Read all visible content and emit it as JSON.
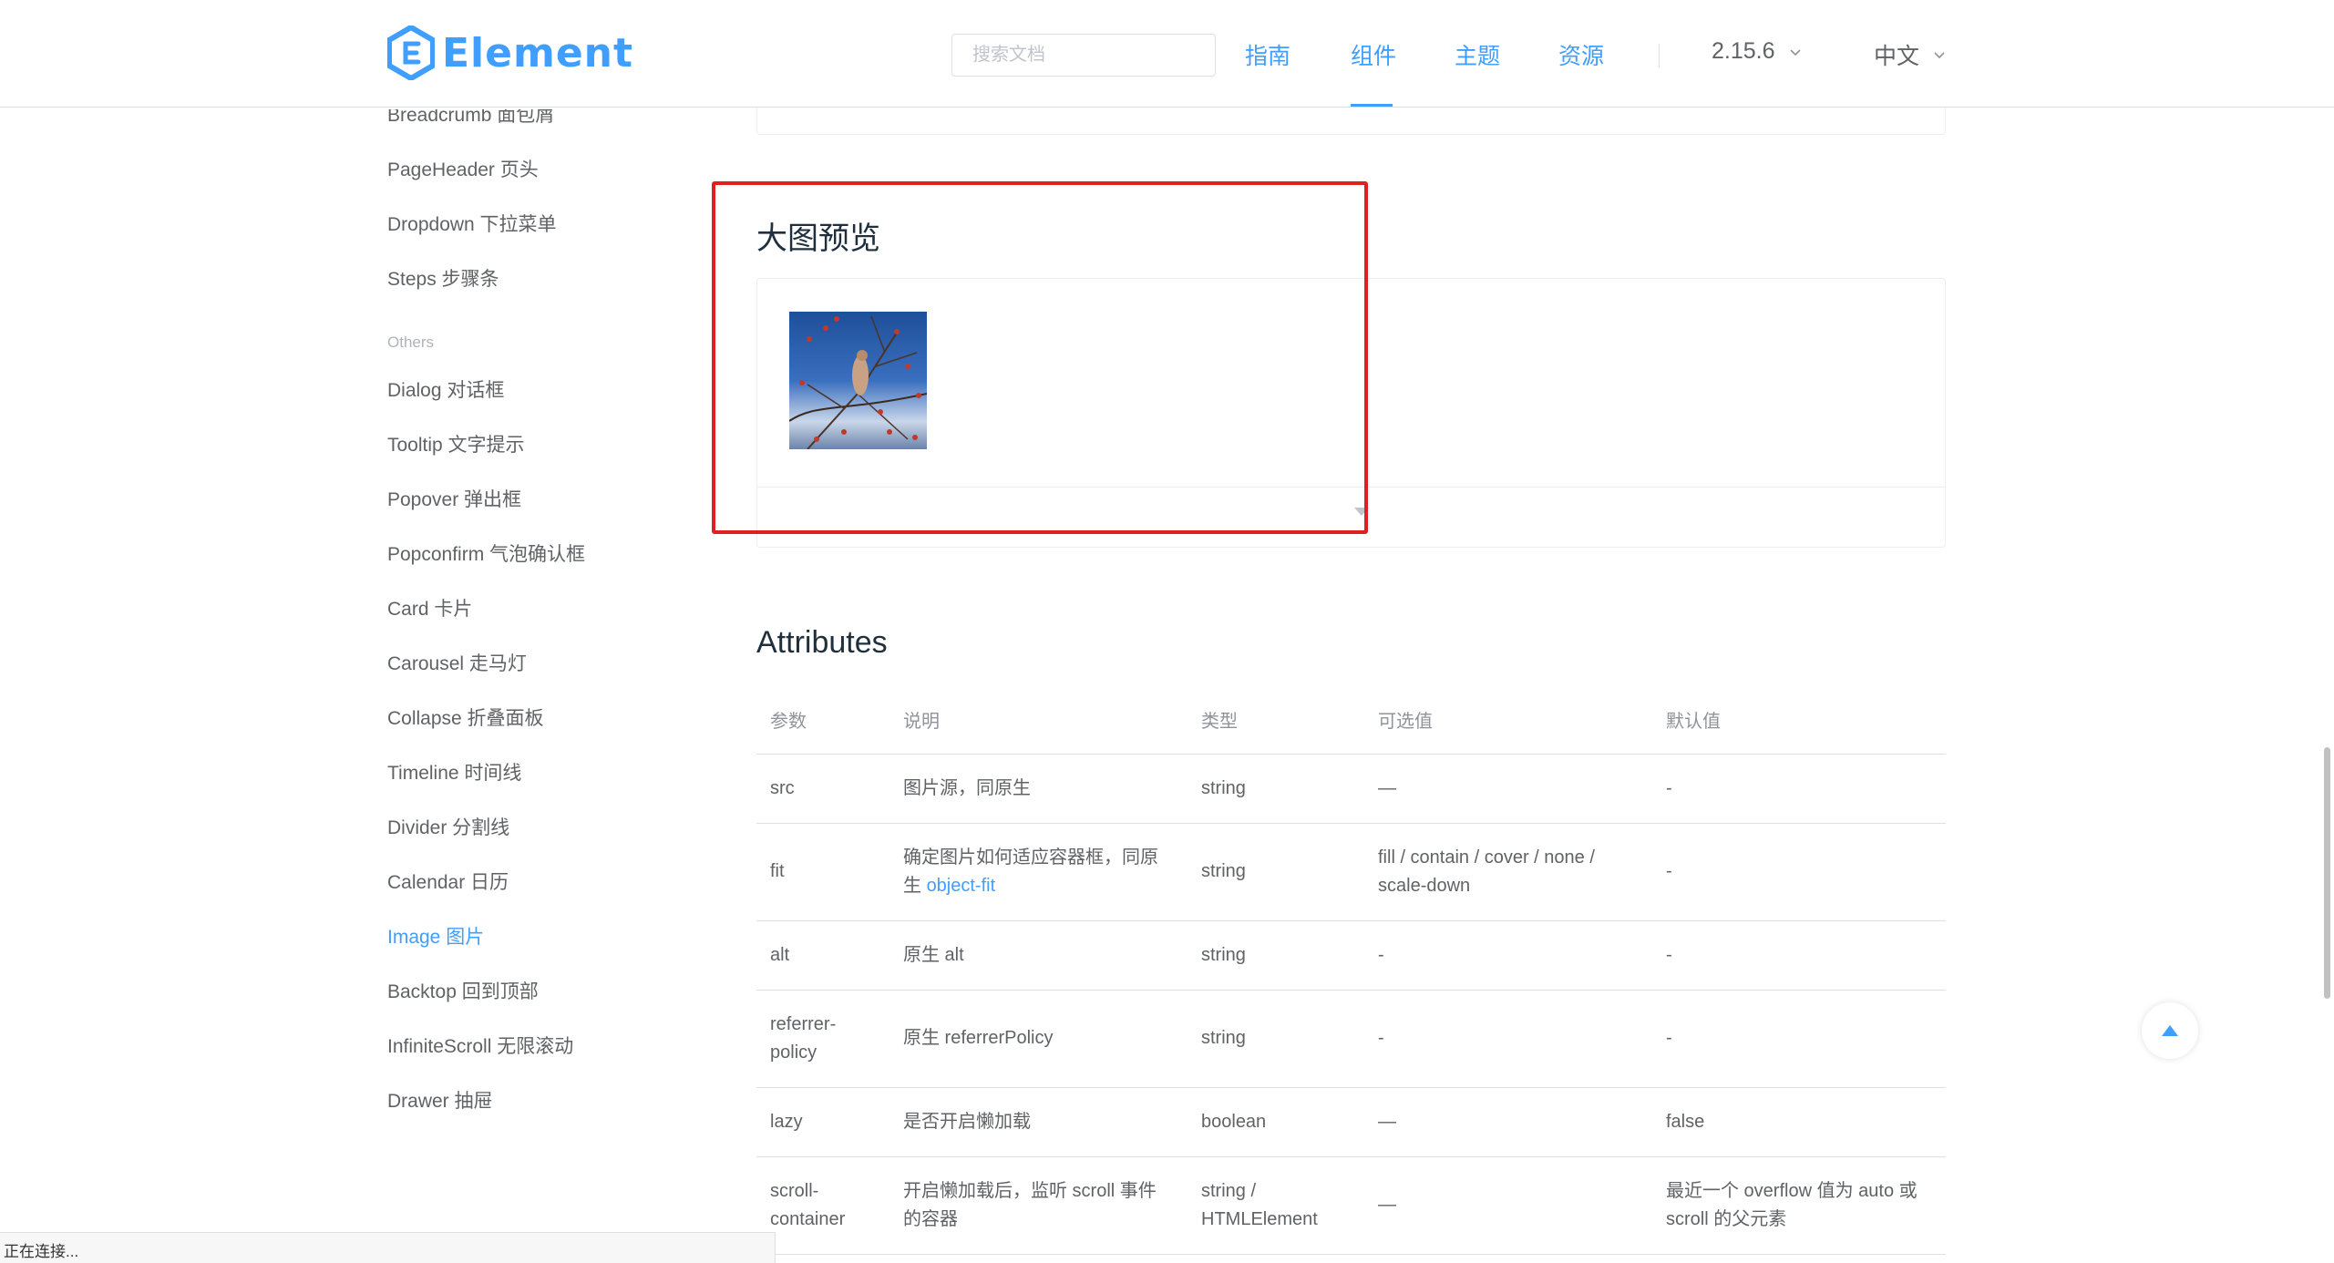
{
  "header": {
    "logo_text": "Element",
    "search_placeholder": "搜索文档",
    "nav": [
      "指南",
      "组件",
      "主题",
      "资源"
    ],
    "version": "2.15.6",
    "language": "中文",
    "accent": "#409eff"
  },
  "sidebar": {
    "items_top": [
      "Breadcrumb 面包屑",
      "PageHeader 页头",
      "Dropdown 下拉菜单",
      "Steps 步骤条"
    ],
    "group_label": "Others",
    "items_others": [
      "Dialog 对话框",
      "Tooltip 文字提示",
      "Popover 弹出框",
      "Popconfirm 气泡确认框",
      "Card 卡片",
      "Carousel 走马灯",
      "Collapse 折叠面板",
      "Timeline 时间线",
      "Divider 分割线",
      "Calendar 日历",
      "Image 图片",
      "Backtop 回到顶部",
      "InfiniteScroll 无限滚动",
      "Drawer 抽屉"
    ],
    "active_item": "Image 图片"
  },
  "main": {
    "preview_title": "大图预览",
    "attributes_title": "Attributes",
    "table": {
      "headers": [
        "参数",
        "说明",
        "类型",
        "可选值",
        "默认值"
      ],
      "rows": [
        [
          "src",
          "图片源，同原生",
          "string",
          "—",
          "-"
        ],
        [
          "fit",
          "确定图片如何适应容器框，同原生",
          "string",
          "fill / contain / cover / none / scale-down",
          "-"
        ],
        [
          "alt",
          "原生 alt",
          "string",
          "-",
          "-"
        ],
        [
          "referrer-policy",
          "原生 referrerPolicy",
          "string",
          "-",
          "-"
        ],
        [
          "lazy",
          "是否开启懒加载",
          "boolean",
          "—",
          "false"
        ],
        [
          "scroll-container",
          "开启懒加载后，监听 scroll 事件的容器",
          "string / HTMLElement",
          "—",
          "最近一个 overflow 值为 auto 或 scroll 的父元素"
        ]
      ],
      "fit_link_text": "object-fit",
      "fit_desc_prefix": "确定图片如何适应容器框，同原生 "
    }
  },
  "status_bar": "正在连接...",
  "highlight_color": "#e02020"
}
